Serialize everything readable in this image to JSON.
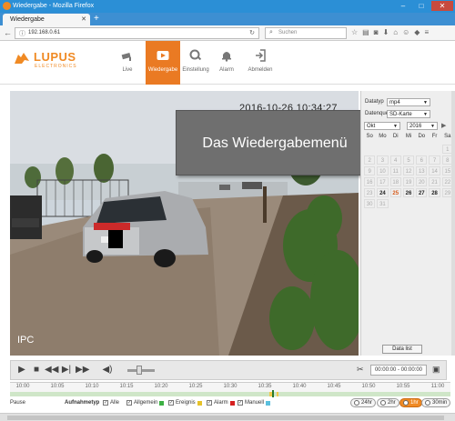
{
  "browser": {
    "window_title": "Wiedergabe - Mozilla Firefox",
    "tab_title": "Wiedergabe",
    "url": "192.168.0.61",
    "search_placeholder": "Suchen"
  },
  "app": {
    "logo_text": "LUPUS",
    "logo_subtext": "ELECTRONICS",
    "nav": [
      {
        "label": "Live",
        "icon": "camera-icon",
        "active": false
      },
      {
        "label": "Wiedergabe",
        "icon": "play-icon",
        "active": true
      },
      {
        "label": "Einstellung",
        "icon": "settings-icon",
        "active": false
      },
      {
        "label": "Alarm",
        "icon": "bell-icon",
        "active": false
      },
      {
        "label": "Abmelden",
        "icon": "logout-icon",
        "active": false
      }
    ]
  },
  "video": {
    "timestamp": "2016-10-26 10:34:27",
    "camera_label": "IPC",
    "overlay_text": "Das Wiedergabemenü"
  },
  "side": {
    "datatype_label": "Datatyp",
    "datatype_value": "mp4",
    "source_label": "Datenquelle",
    "source_value": "SD-Karte",
    "month_value": "Okt",
    "year_value": "2016",
    "weekdays": [
      "So",
      "Mo",
      "Di",
      "Mi",
      "Do",
      "Fr",
      "Sa"
    ],
    "days": [
      {
        "d": "",
        "s": "empty"
      },
      {
        "d": "",
        "s": "empty"
      },
      {
        "d": "",
        "s": "empty"
      },
      {
        "d": "",
        "s": "empty"
      },
      {
        "d": "",
        "s": "empty"
      },
      {
        "d": "",
        "s": "empty"
      },
      {
        "d": "1",
        "s": ""
      },
      {
        "d": "2",
        "s": ""
      },
      {
        "d": "3",
        "s": ""
      },
      {
        "d": "4",
        "s": ""
      },
      {
        "d": "5",
        "s": ""
      },
      {
        "d": "6",
        "s": ""
      },
      {
        "d": "7",
        "s": ""
      },
      {
        "d": "8",
        "s": ""
      },
      {
        "d": "9",
        "s": ""
      },
      {
        "d": "10",
        "s": ""
      },
      {
        "d": "11",
        "s": ""
      },
      {
        "d": "12",
        "s": ""
      },
      {
        "d": "13",
        "s": ""
      },
      {
        "d": "14",
        "s": ""
      },
      {
        "d": "15",
        "s": ""
      },
      {
        "d": "16",
        "s": ""
      },
      {
        "d": "17",
        "s": ""
      },
      {
        "d": "18",
        "s": ""
      },
      {
        "d": "19",
        "s": ""
      },
      {
        "d": "20",
        "s": ""
      },
      {
        "d": "21",
        "s": ""
      },
      {
        "d": "22",
        "s": ""
      },
      {
        "d": "23",
        "s": ""
      },
      {
        "d": "24",
        "s": "has"
      },
      {
        "d": "25",
        "s": "rec"
      },
      {
        "d": "26",
        "s": "has"
      },
      {
        "d": "27",
        "s": "has"
      },
      {
        "d": "28",
        "s": "has"
      },
      {
        "d": "29",
        "s": ""
      },
      {
        "d": "30",
        "s": ""
      },
      {
        "d": "31",
        "s": ""
      }
    ],
    "datalist_button": "Data list"
  },
  "controls": {
    "time_range": "00:00:00 - 00:00:00"
  },
  "timeline": {
    "ticks": [
      "10:00",
      "10:05",
      "10:10",
      "10:15",
      "10:20",
      "10:25",
      "10:30",
      "10:35",
      "10:40",
      "10:45",
      "10:50",
      "10:55",
      "11:00"
    ]
  },
  "legend": {
    "pause_label": "Pause",
    "recording_type_label": "Aufnahmetyp",
    "items": [
      {
        "label": "Alle",
        "color": "#ffffff"
      },
      {
        "label": "Allgemein",
        "color": "#3cb043"
      },
      {
        "label": "Ereignis",
        "color": "#e6c229"
      },
      {
        "label": "Alarm",
        "color": "#d62020"
      },
      {
        "label": "Manuell",
        "color": "#5bc0de"
      }
    ],
    "zoom": [
      {
        "label": "24hr",
        "active": false
      },
      {
        "label": "2hr",
        "active": false
      },
      {
        "label": "1hr",
        "active": true
      },
      {
        "label": "30min",
        "active": false
      }
    ]
  }
}
